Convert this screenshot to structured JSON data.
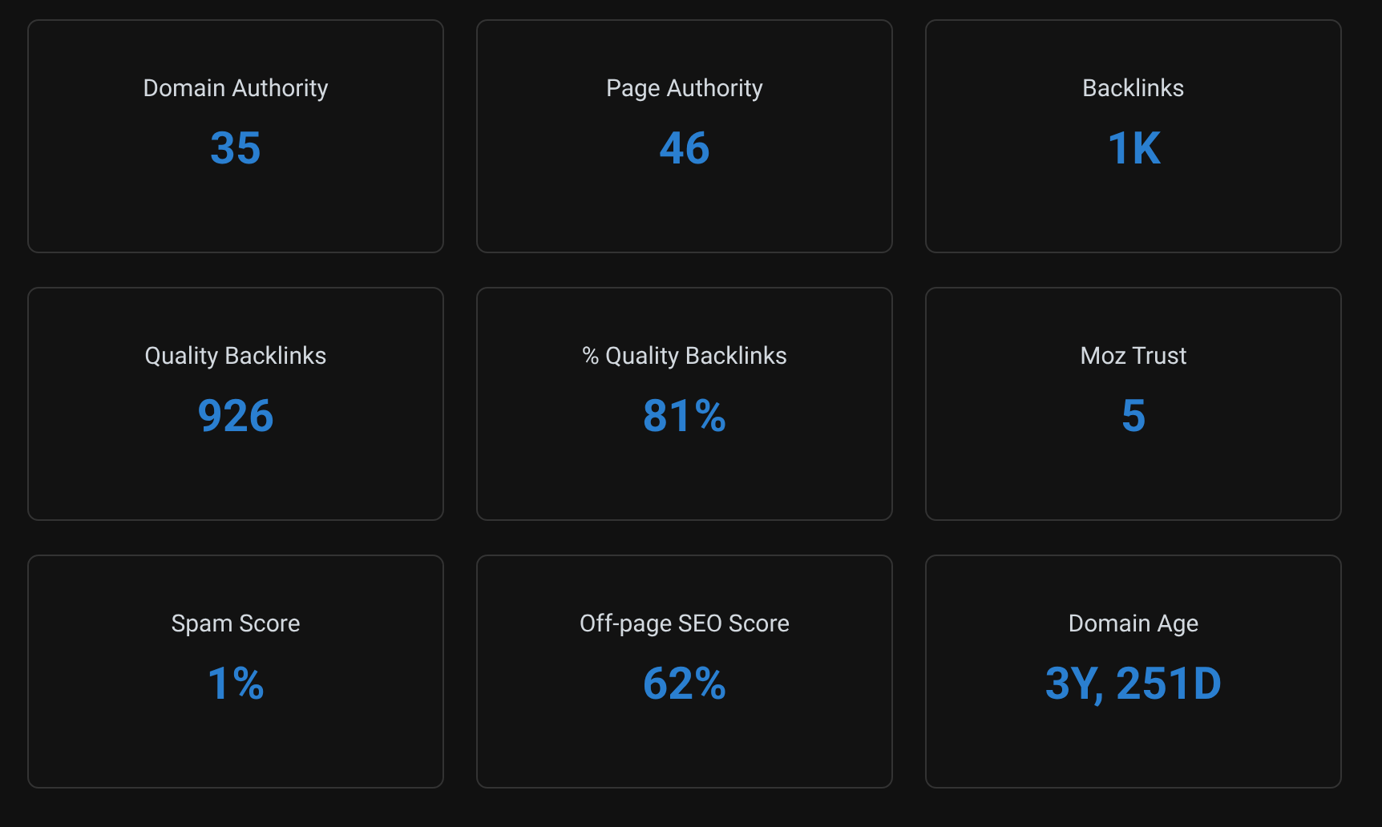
{
  "metrics": [
    {
      "label": "Domain Authority",
      "value": "35"
    },
    {
      "label": "Page Authority",
      "value": "46"
    },
    {
      "label": "Backlinks",
      "value": "1K"
    },
    {
      "label": "Quality Backlinks",
      "value": "926"
    },
    {
      "label": "% Quality Backlinks",
      "value": "81%"
    },
    {
      "label": "Moz Trust",
      "value": "5"
    },
    {
      "label": "Spam Score",
      "value": "1%"
    },
    {
      "label": "Off-page SEO Score",
      "value": "62%"
    },
    {
      "label": "Domain Age",
      "value": "3Y, 251D"
    }
  ]
}
